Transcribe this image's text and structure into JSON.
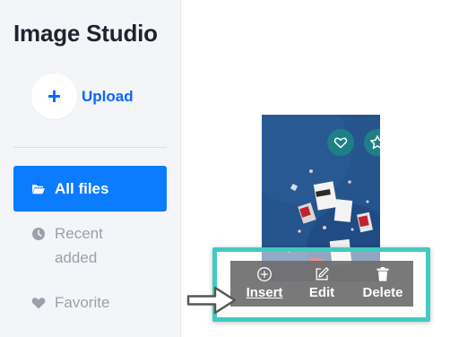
{
  "app": {
    "title": "Image Studio"
  },
  "sidebar": {
    "upload_label": "Upload",
    "upload_icon": "plus-icon",
    "items": [
      {
        "label": "All files",
        "icon": "folder-open-icon",
        "active": true
      },
      {
        "label": "Recent added",
        "icon": "clock-icon",
        "active": false
      },
      {
        "label": "Favorite",
        "icon": "heart-icon",
        "active": false
      }
    ]
  },
  "thumbnail": {
    "favorite_icon": "heart-icon",
    "star_icon": "star-icon"
  },
  "actions": {
    "insert_label": "Insert",
    "edit_label": "Edit",
    "delete_label": "Delete"
  },
  "colors": {
    "accent": "#0b7bff",
    "highlight": "#41cbc0",
    "sidebar_bg": "#f4f5f8",
    "badge_teal": "#1f7f86"
  }
}
